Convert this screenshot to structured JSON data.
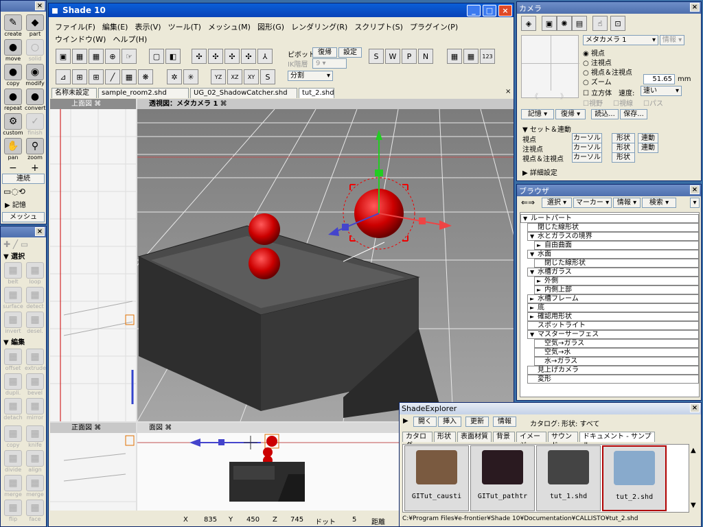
{
  "app": {
    "title": "Shade 10"
  },
  "menus": [
    "ファイル(F)",
    "編集(E)",
    "表示(V)",
    "ツール(T)",
    "メッシュ(M)",
    "図形(G)",
    "レンダリング(R)",
    "スクリプト(S)",
    "プラグイン(P)",
    "ウインドウ(W)",
    "ヘルプ(H)"
  ],
  "toolbar": {
    "pivot_label": "ピボット",
    "restore_label": "復帰",
    "settings_label": "設定",
    "ik_label": "IK階層",
    "ik_value": "9",
    "split_label": "分割"
  },
  "doc_tabs": [
    "名称未設定",
    "sample_room2.shd",
    "UG_02_ShadowCatcher.shd",
    "tut_2.shd"
  ],
  "tools": {
    "create": "create",
    "part": "part",
    "move": "move",
    "solid": "solid",
    "copy": "copy",
    "modify": "modify",
    "repeat": "repeat",
    "convert": "convert",
    "custom": "custom",
    "finish": "finish",
    "pan": "pan",
    "zoom": "zoom",
    "renzoku": "連続",
    "kioku": "記憶",
    "mesh": "メッシュ"
  },
  "mesh_panel": {
    "select_label": "選択",
    "edit_label": "編集",
    "items": [
      "belt",
      "loop",
      "surface",
      "detect",
      "invert",
      "desel.",
      "offset",
      "extrude",
      "dupli.",
      "bevel",
      "detach",
      "mirror",
      "copy",
      "knife",
      "divide",
      "align",
      "merge",
      "merge",
      "flip",
      "face"
    ]
  },
  "viewports": {
    "top": "上面図",
    "persp": "透視図：メタカメラ 1",
    "front": "正面図",
    "side": "面図"
  },
  "statusbar": {
    "x_label": "X",
    "x": "835",
    "y_label": "Y",
    "y": "450",
    "z_label": "Z",
    "z": "745",
    "dot_label": "ドット",
    "dot": "5",
    "dist_label": "距離"
  },
  "camera": {
    "title": "カメラ",
    "camera_select": "メタカメラ 1",
    "info_label": "情報",
    "radio": [
      "視点",
      "注視点",
      "視点＆注視点",
      "ズーム"
    ],
    "zoom_value": "51.65",
    "zoom_unit": "mm",
    "solid_label": "立方体",
    "speed_label": "速度:",
    "speed_value": "速い",
    "checks": [
      "視野",
      "視線",
      "パス"
    ],
    "memory_label": "記憶",
    "restore_label": "復帰",
    "load_label": "読込...",
    "save_label": "保存...",
    "set_section": "セット＆連動",
    "rows": [
      {
        "label": "視点",
        "a": "カーソル",
        "b": "形状",
        "c": "連動"
      },
      {
        "label": "注視点",
        "a": "カーソル",
        "b": "形状",
        "c": "連動"
      },
      {
        "label": "視点＆注視点",
        "a": "カーソル",
        "b": "形状",
        "c": ""
      }
    ],
    "detail_section": "詳細設定"
  },
  "browser": {
    "title": "ブラウザ",
    "select": "選択",
    "marker": "マーカー",
    "info": "情報",
    "search": "検索",
    "tree": [
      {
        "t": "ルートパート",
        "d": 0,
        "tw": "▼"
      },
      {
        "t": "閉じた線形状",
        "d": 1,
        "tw": ""
      },
      {
        "t": "水とガラスの境界",
        "d": 1,
        "tw": "▼"
      },
      {
        "t": "自由曲面",
        "d": 2,
        "tw": "►"
      },
      {
        "t": "水面",
        "d": 1,
        "tw": "▼"
      },
      {
        "t": "閉じた線形状",
        "d": 2,
        "tw": ""
      },
      {
        "t": "水槽ガラス",
        "d": 1,
        "tw": "▼"
      },
      {
        "t": "外側",
        "d": 2,
        "tw": "►"
      },
      {
        "t": "内側上部",
        "d": 2,
        "tw": "►"
      },
      {
        "t": "水槽フレーム",
        "d": 1,
        "tw": "►"
      },
      {
        "t": "底",
        "d": 1,
        "tw": "►"
      },
      {
        "t": "確認用形状",
        "d": 1,
        "tw": "►"
      },
      {
        "t": "スポットライト",
        "d": 1,
        "tw": ""
      },
      {
        "t": "マスターサーフェス",
        "d": 1,
        "tw": "▼"
      },
      {
        "t": "空気→ガラス",
        "d": 2,
        "tw": ""
      },
      {
        "t": "空気→水",
        "d": 2,
        "tw": ""
      },
      {
        "t": "水→ガラス",
        "d": 2,
        "tw": ""
      },
      {
        "t": "見上げカメラ",
        "d": 1,
        "tw": ""
      },
      {
        "t": "変形",
        "d": 1,
        "tw": ""
      }
    ]
  },
  "explorer": {
    "title": "ShadeExplorer",
    "open": "開く",
    "insert": "挿入",
    "update": "更新",
    "info": "情報",
    "catalog_label": "カタログ:",
    "catalog_value": "形状: すべて",
    "tabs": [
      "カタログ",
      "形状",
      "表面材質",
      "背景",
      "イメージ",
      "サウンド",
      "ドキュメント - サンプル"
    ],
    "files": [
      "GITut_causti",
      "GITut_pathtr",
      "tut_1.shd",
      "tut_2.shd"
    ],
    "path": "C:¥Program Files¥e-frontier¥Shade 10¥Documentation¥CALLISTO¥tut_2.shd"
  },
  "colors": {
    "accent": "#0a5fd8",
    "sphere": "#cc0000",
    "viewport_bg": "#9a9a9a"
  }
}
